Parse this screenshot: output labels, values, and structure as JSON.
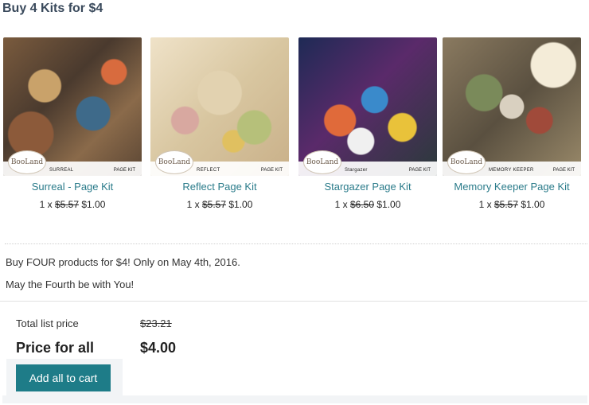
{
  "header": {
    "title": "Buy 4 Kits for $4"
  },
  "products": [
    {
      "name": "Surreal - Page Kit",
      "qty": "1 x",
      "old_price": "$5.57",
      "price": "$1.00",
      "image_label": "SURREAL",
      "image_type": "PAGE KIT",
      "logo": "BooLand"
    },
    {
      "name": "Reflect Page Kit",
      "qty": "1 x",
      "old_price": "$5.57",
      "price": "$1.00",
      "image_label": "REFLECT",
      "image_type": "PAGE KIT",
      "logo": "BooLand"
    },
    {
      "name": "Stargazer Page Kit",
      "qty": "1 x",
      "old_price": "$6.50",
      "price": "$1.00",
      "image_label": "Stargazer",
      "image_type": "PAGE KIT",
      "logo": "BooLand"
    },
    {
      "name": "Memory Keeper Page Kit",
      "qty": "1 x",
      "old_price": "$5.57",
      "price": "$1.00",
      "image_label": "MEMORY KEEPER",
      "image_type": "PAGE KIT",
      "logo": "BooLand"
    }
  ],
  "description": {
    "line1": "Buy FOUR products for $4! Only on May 4th, 2016.",
    "line2": "May the Fourth be with You!"
  },
  "summary": {
    "list_label": "Total list price",
    "list_value": "$23.21",
    "all_label": "Price for all",
    "all_value": "$4.00",
    "button_label": "Add all to cart"
  },
  "colors": {
    "accent": "#1e7c88",
    "link": "#2a7b8a",
    "title": "#3a4a5c"
  }
}
